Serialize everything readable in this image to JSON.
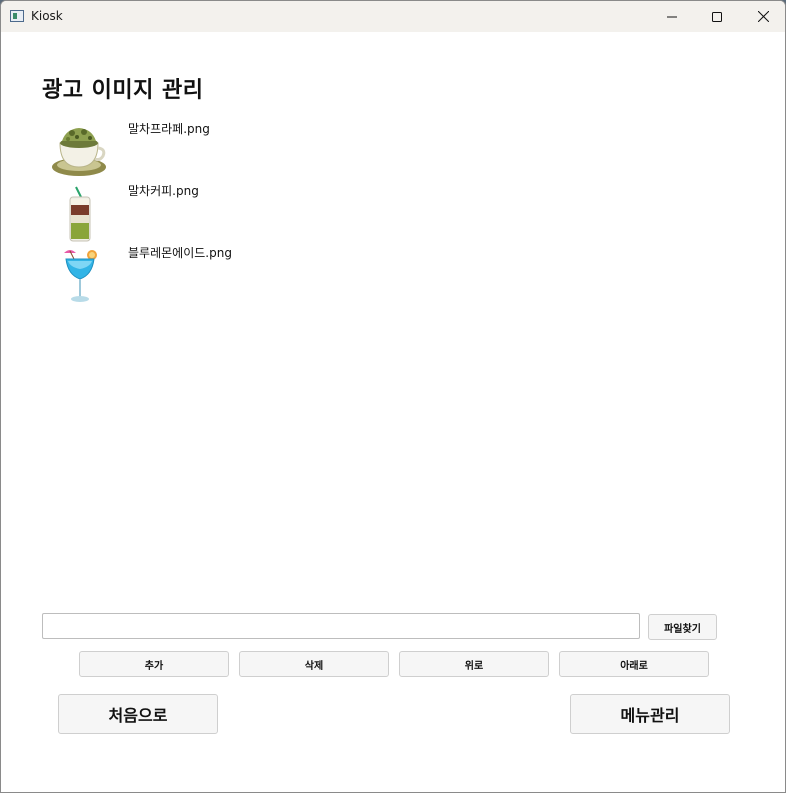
{
  "window": {
    "title": "Kiosk"
  },
  "page": {
    "title": "광고 이미지 관리"
  },
  "images": [
    {
      "name": "말차프라페.png",
      "icon": "matcha-frappe-thumbnail"
    },
    {
      "name": "말차커피.png",
      "icon": "matcha-coffee-thumbnail"
    },
    {
      "name": "블루레몬에이드.png",
      "icon": "blue-lemonade-thumbnail"
    }
  ],
  "file_input": {
    "value": "",
    "placeholder": ""
  },
  "buttons": {
    "browse": "파일찾기",
    "add": "추가",
    "delete": "삭제",
    "up": "위로",
    "down": "아래로",
    "home": "처음으로",
    "menu_manage": "메뉴관리"
  }
}
